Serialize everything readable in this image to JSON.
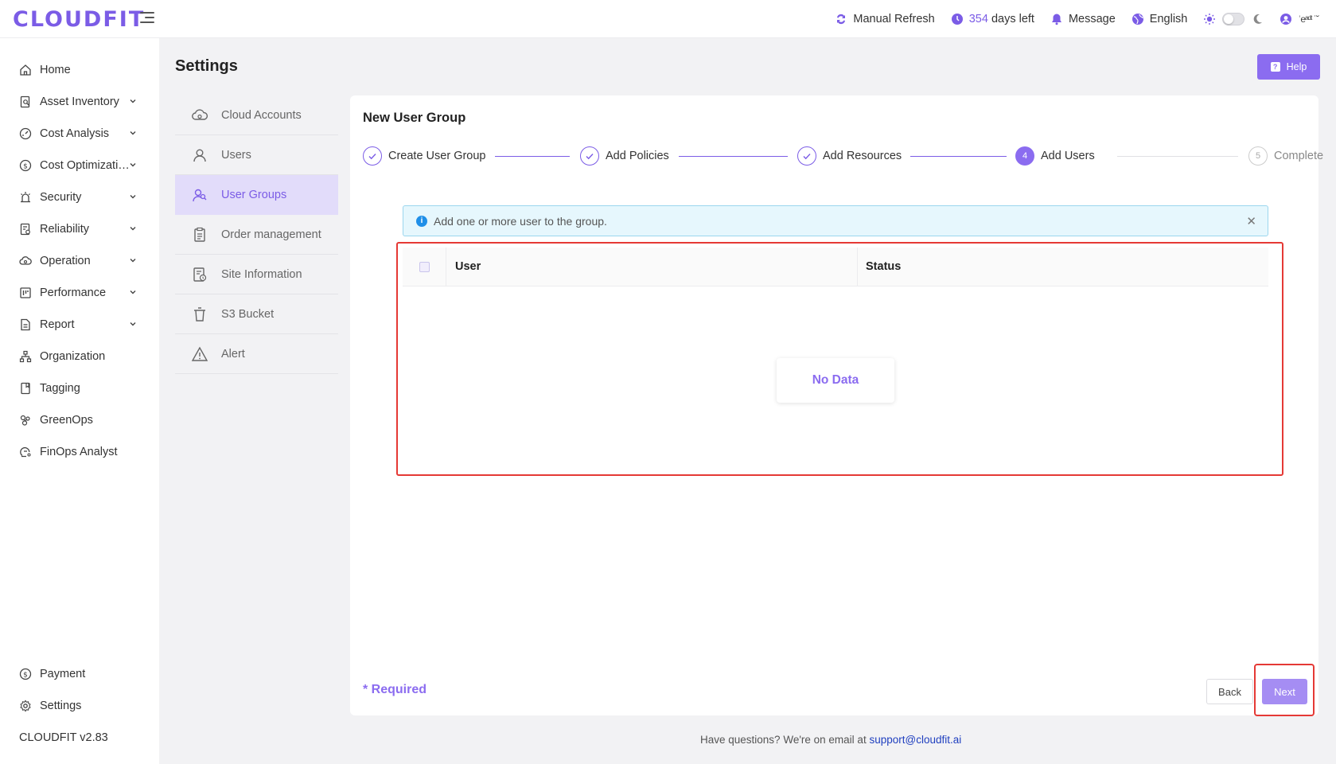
{
  "app": {
    "logo": "CLOUDFIT",
    "accent_color": "#7b5ce6"
  },
  "header": {
    "refresh_label": "Manual Refresh",
    "days_number": "354",
    "days_suffix": "days left",
    "message_label": "Message",
    "language_label": "English",
    "user_name": "ʿeᵃᵈᵗ ˙˘",
    "icons": [
      "refresh-icon",
      "clock-icon",
      "bell-icon",
      "globe-icon",
      "sun-icon",
      "moon-icon",
      "user-icon"
    ]
  },
  "sidebar": {
    "items": [
      {
        "label": "Home",
        "icon": "home-icon",
        "expandable": false
      },
      {
        "label": "Asset Inventory",
        "icon": "asset-icon",
        "expandable": true
      },
      {
        "label": "Cost Analysis",
        "icon": "gauge-icon",
        "expandable": true
      },
      {
        "label": "Cost Optimizati…",
        "icon": "dollar-icon",
        "expandable": true
      },
      {
        "label": "Security",
        "icon": "alarm-icon",
        "expandable": true
      },
      {
        "label": "Reliability",
        "icon": "reliability-icon",
        "expandable": true
      },
      {
        "label": "Operation",
        "icon": "cloud-gear-icon",
        "expandable": true
      },
      {
        "label": "Performance",
        "icon": "board-icon",
        "expandable": true
      },
      {
        "label": "Report",
        "icon": "report-icon",
        "expandable": true
      },
      {
        "label": "Organization",
        "icon": "org-icon",
        "expandable": false
      },
      {
        "label": "Tagging",
        "icon": "tag-icon",
        "expandable": false
      },
      {
        "label": "GreenOps",
        "icon": "greenops-icon",
        "expandable": false
      },
      {
        "label": "FinOps Analyst",
        "icon": "finops-icon",
        "expandable": false
      }
    ],
    "payment_label": "Payment",
    "settings_label": "Settings",
    "version": "CLOUDFIT v2.83"
  },
  "page": {
    "title": "Settings",
    "help_label": "Help"
  },
  "settings_menu": {
    "items": [
      {
        "label": "Cloud Accounts",
        "icon": "cloud-icon"
      },
      {
        "label": "Users",
        "icon": "user-icon"
      },
      {
        "label": "User Groups",
        "icon": "user-group-icon",
        "active": true
      },
      {
        "label": "Order management",
        "icon": "clipboard-icon"
      },
      {
        "label": "Site Information",
        "icon": "site-info-icon"
      },
      {
        "label": "S3 Bucket",
        "icon": "bucket-icon"
      },
      {
        "label": "Alert",
        "icon": "warning-icon"
      }
    ]
  },
  "wizard": {
    "title": "New User Group",
    "steps": [
      {
        "label": "Create User Group",
        "state": "done"
      },
      {
        "label": "Add Policies",
        "state": "done"
      },
      {
        "label": "Add Resources",
        "state": "done"
      },
      {
        "label": "Add Users",
        "state": "current",
        "number": "4"
      },
      {
        "label": "Complete",
        "state": "todo",
        "number": "5"
      }
    ],
    "alert_text": "Add one or more user to the group.",
    "table": {
      "columns": [
        "User",
        "Status"
      ],
      "rows": [],
      "empty_text": "No Data"
    },
    "required_label": "* Required",
    "back_label": "Back",
    "next_label": "Next"
  },
  "footer": {
    "text": "Have questions? We're on email at",
    "email": "support@cloudfit.ai"
  }
}
